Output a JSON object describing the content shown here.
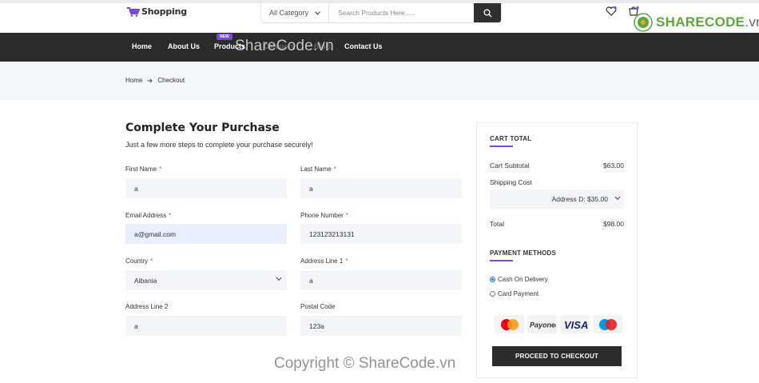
{
  "header": {
    "logo_text": "Shopping",
    "category_select": "All Category",
    "search_placeholder": "Search Products Here.....",
    "watermark_brand": "SHARECODE",
    "watermark_tld": ".vn"
  },
  "nav": {
    "items": [
      "Home",
      "About Us",
      "Products",
      "Category",
      "Blog",
      "Contact Us"
    ],
    "new_badge": "NEW",
    "watermark": "ShareCode.vn"
  },
  "breadcrumb": {
    "home": "Home",
    "current": "Checkout"
  },
  "form": {
    "title": "Complete Your Purchase",
    "subtitle": "Just a few more steps to complete your purchase securely!",
    "required_mark": "*",
    "first_name": {
      "label": "First Name",
      "value": "a"
    },
    "last_name": {
      "label": "Last Name",
      "value": "a"
    },
    "email": {
      "label": "Email Address",
      "value": "a@gmail.com"
    },
    "phone": {
      "label": "Phone Number",
      "value": "123123213131"
    },
    "country": {
      "label": "Country",
      "value": "Albania"
    },
    "address1": {
      "label": "Address Line 1",
      "value": "a"
    },
    "address2": {
      "label": "Address Line 2",
      "value": "a"
    },
    "postal": {
      "label": "Postal Code",
      "value": "123a"
    }
  },
  "cart": {
    "heading": "CART TOTAL",
    "subtotal_label": "Cart Subtotal",
    "subtotal_value": "$63.00",
    "shipping_label": "Shipping Cost",
    "shipping_option": "Address D: $35.00",
    "total_label": "Total",
    "total_value": "$98.00",
    "payment_heading": "PAYMENT METHODS",
    "payment_options": [
      "Cash On Delivery",
      "Card Payment"
    ],
    "selected_payment": "Cash On Delivery",
    "card_logos": [
      "MasterCard",
      "Payoneer",
      "VISA",
      "Maestro"
    ],
    "checkout_button": "PROCEED TO CHECKOUT"
  },
  "footer_watermark": "Copyright © ShareCode.vn",
  "colors": {
    "accent": "#7b49d8",
    "dark": "#2b2b2b",
    "band": "#f5f6fa",
    "required": "#e5484d"
  }
}
